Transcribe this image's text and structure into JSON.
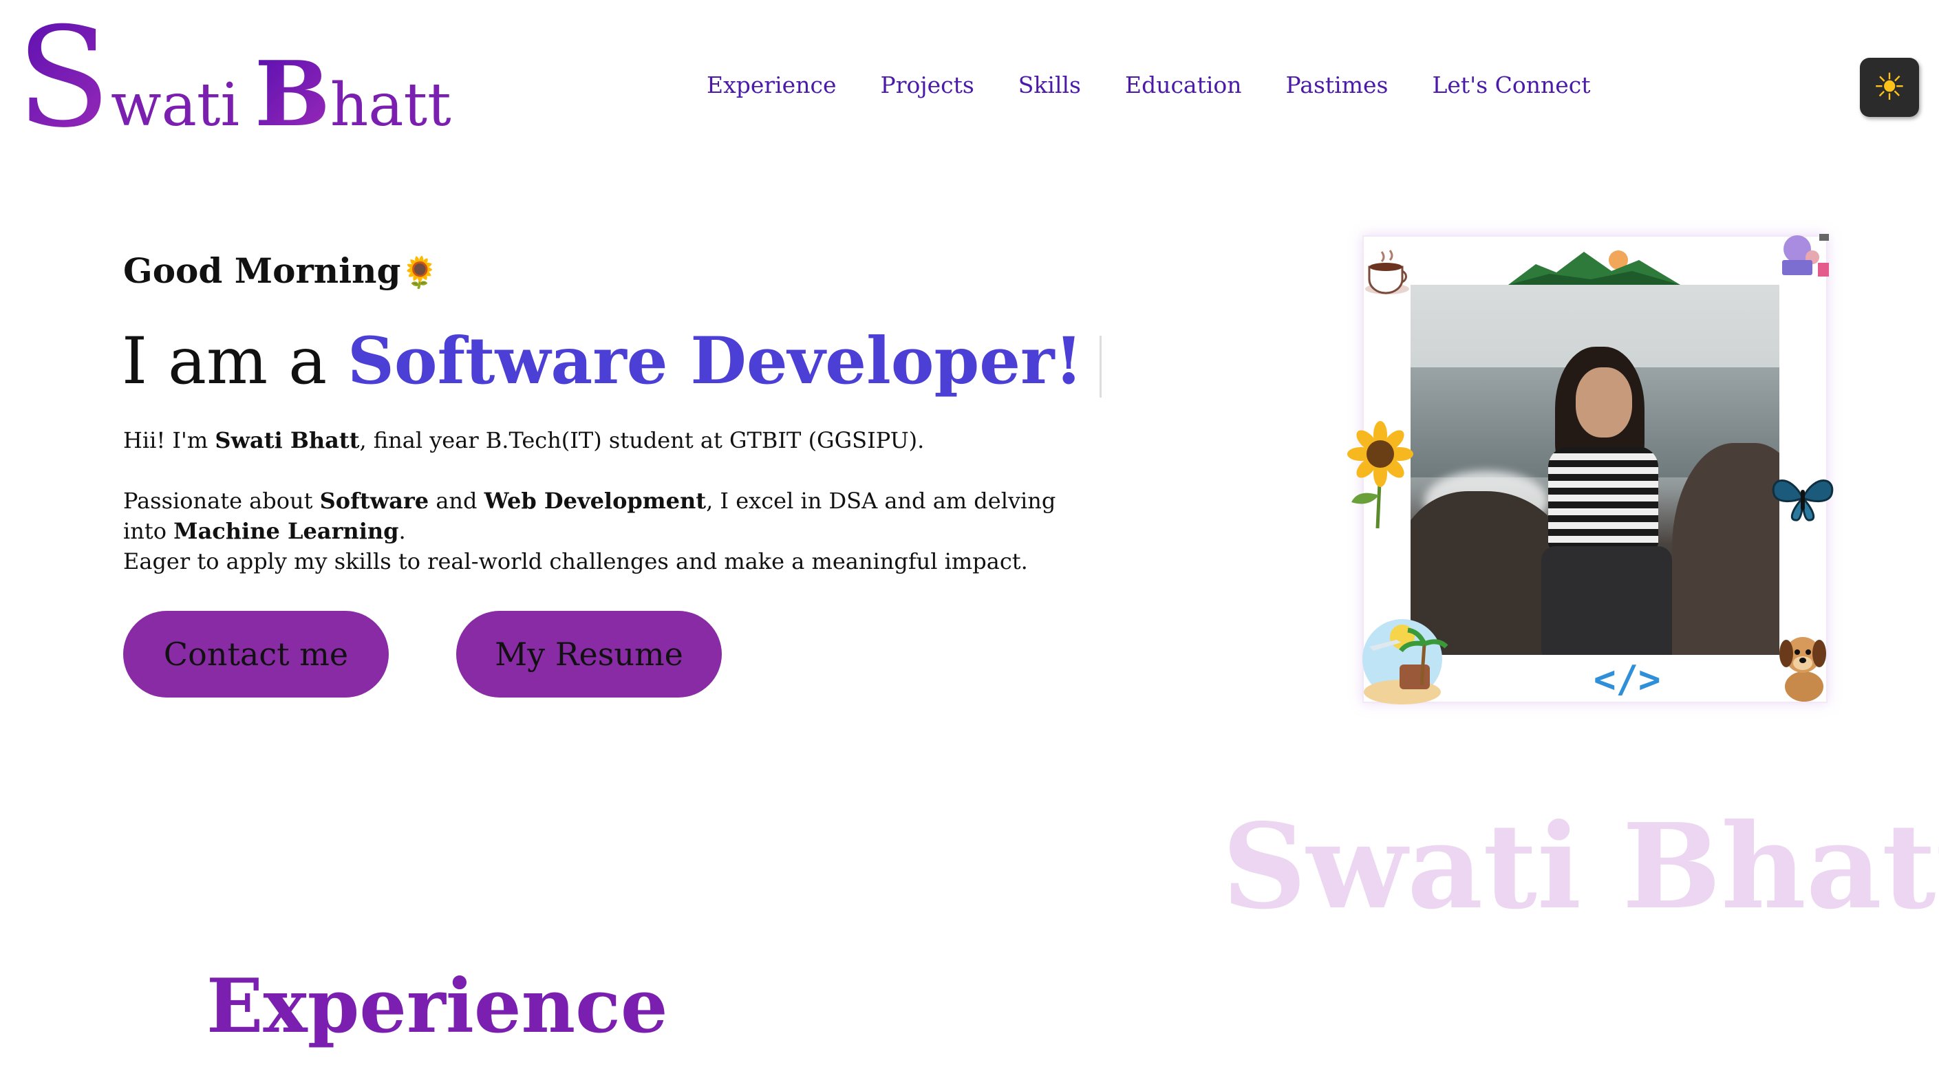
{
  "header": {
    "logo": {
      "first_initial": "S",
      "first_rest": "wati",
      "last_initial": "B",
      "last_rest": "hatt"
    },
    "nav": [
      "Experience",
      "Projects",
      "Skills",
      "Education",
      "Pastimes",
      "Let's Connect"
    ],
    "theme_toggle_icon": "sun-icon"
  },
  "hero": {
    "greeting": "Good Morning",
    "greeting_emoji": "🌻",
    "headline_prefix": "I am a",
    "headline_role": "Software Developer!",
    "intro": {
      "line1_a": "Hii! I'm ",
      "line1_name": "Swati Bhatt",
      "line1_b": ", final year B.Tech(IT) student at GTBIT (GGSIPU).",
      "line2_a": "Passionate about ",
      "line2_b1": "Software",
      "line2_c": " and ",
      "line2_b2": "Web Development",
      "line2_d": ", I excel in DSA and am delving into ",
      "line2_b3": "Machine Learning",
      "line2_e": ".",
      "line3": "Eager to apply my skills to real-world challenges and make a meaningful impact."
    },
    "buttons": {
      "contact": "Contact me",
      "resume": "My Resume"
    }
  },
  "photo_frame": {
    "code_symbol": "</>",
    "decorations": [
      "coffee-cup-icon",
      "mountain-icon",
      "laptop-girl-icon",
      "sunflower-icon",
      "butterfly-icon",
      "travel-icon",
      "puppy-icon"
    ]
  },
  "watermark": "Swati Bhatt",
  "section": {
    "title": "Experience"
  },
  "colors": {
    "brand_purple": "#8a2ba6",
    "nav_text": "#4b1aa8",
    "role_blue": "#4b3fd6",
    "watermark": "#ecd6f1"
  }
}
